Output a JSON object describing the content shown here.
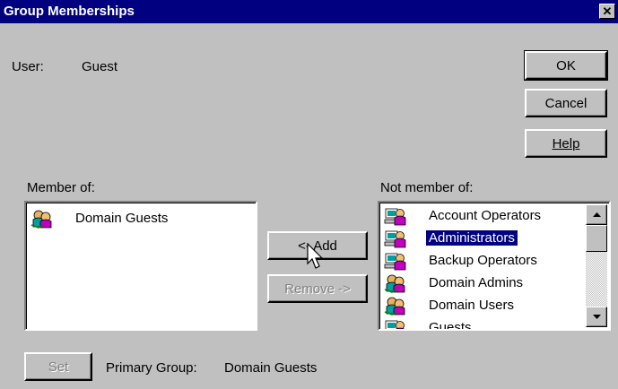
{
  "window": {
    "title": "Group Memberships",
    "close_glyph": "✕"
  },
  "user": {
    "label": "User:",
    "value": "Guest"
  },
  "buttons": {
    "ok": "OK",
    "cancel": "Cancel",
    "help": "Help",
    "add": "<- Add",
    "remove": "Remove ->",
    "set": "Set"
  },
  "member_of": {
    "label": "Member of:",
    "items": [
      {
        "label": "Domain Guests",
        "icon": "group-icon"
      }
    ]
  },
  "not_member_of": {
    "label": "Not member of:",
    "items": [
      {
        "label": "Account Operators",
        "icon": "local-group-icon"
      },
      {
        "label": "Administrators",
        "icon": "local-group-icon",
        "selected": true
      },
      {
        "label": "Backup Operators",
        "icon": "local-group-icon"
      },
      {
        "label": "Domain Admins",
        "icon": "group-icon"
      },
      {
        "label": "Domain Users",
        "icon": "group-icon"
      },
      {
        "label": "Guests",
        "icon": "local-group-icon"
      }
    ]
  },
  "primary_group": {
    "label": "Primary Group:",
    "value": "Domain Guests"
  },
  "colors": {
    "title_bar": "#000080",
    "face": "#c0c0c0",
    "selection": "#000080"
  }
}
